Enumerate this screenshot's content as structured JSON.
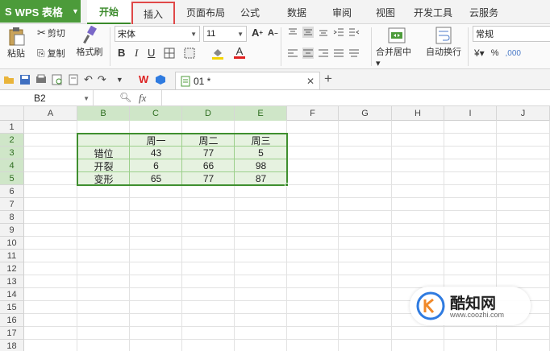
{
  "app": {
    "name": "WPS 表格"
  },
  "menu": {
    "tabs": [
      "开始",
      "插入",
      "页面布局",
      "公式",
      "数据",
      "审阅",
      "视图",
      "开发工具",
      "云服务"
    ],
    "active": "开始",
    "highlighted": "插入"
  },
  "ribbon": {
    "paste": "粘贴",
    "cut": "剪切",
    "copy": "复制",
    "format_painter": "格式刷",
    "font_name": "宋体",
    "font_size": "11",
    "merge_center": "合并居中",
    "wrap_text": "自动换行",
    "number_format": "常规",
    "percent": "%"
  },
  "document": {
    "tab_title": "01 *"
  },
  "formula_bar": {
    "cell_ref": "B2",
    "fx": "fx"
  },
  "grid": {
    "columns": [
      "A",
      "B",
      "C",
      "D",
      "E",
      "F",
      "G",
      "H",
      "I",
      "J"
    ],
    "selected_columns": [
      "B",
      "C",
      "D",
      "E"
    ],
    "rows": [
      "1",
      "2",
      "3",
      "4",
      "5",
      "6",
      "7",
      "8",
      "9",
      "10",
      "11",
      "12",
      "13",
      "14",
      "15",
      "16",
      "17",
      "18"
    ],
    "selected_rows": [
      "2",
      "3",
      "4",
      "5"
    ],
    "selection": "B2:E5"
  },
  "table": {
    "headers": [
      "",
      "周一",
      "周二",
      "周三"
    ],
    "rows": [
      [
        "错位",
        "43",
        "77",
        "5"
      ],
      [
        "开裂",
        "6",
        "66",
        "98"
      ],
      [
        "变形",
        "65",
        "77",
        "87"
      ]
    ]
  },
  "colors": {
    "accent": "#4c9b3a",
    "selection": "#3f8f2f",
    "highlight_box": "#e04848"
  },
  "watermark": {
    "brand": "酷知网",
    "url": "www.coozhi.com"
  }
}
